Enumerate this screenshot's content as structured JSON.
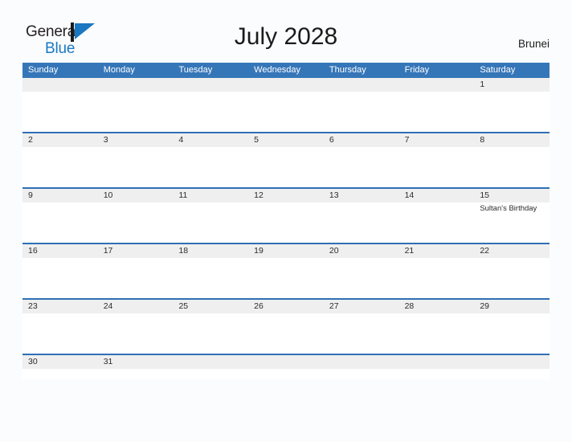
{
  "brand": {
    "word1": "General",
    "word2": "Blue",
    "flag_icon": "blue-triangle-flag-icon",
    "color_dark": "#231f20",
    "color_blue": "#1a78c2"
  },
  "header": {
    "title": "July 2028",
    "country": "Brunei"
  },
  "theme": {
    "header_blue": "#3576b8",
    "row_border_blue": "#2f6fb5",
    "day_band_gray": "#efefef",
    "page_background": "#fbfcfd",
    "text_dark": "#2b2b2b"
  },
  "calendar": {
    "weekdays": [
      "Sunday",
      "Monday",
      "Tuesday",
      "Wednesday",
      "Thursday",
      "Friday",
      "Saturday"
    ],
    "weeks": [
      [
        {
          "date": "",
          "event": ""
        },
        {
          "date": "",
          "event": ""
        },
        {
          "date": "",
          "event": ""
        },
        {
          "date": "",
          "event": ""
        },
        {
          "date": "",
          "event": ""
        },
        {
          "date": "",
          "event": ""
        },
        {
          "date": "1",
          "event": ""
        }
      ],
      [
        {
          "date": "2",
          "event": ""
        },
        {
          "date": "3",
          "event": ""
        },
        {
          "date": "4",
          "event": ""
        },
        {
          "date": "5",
          "event": ""
        },
        {
          "date": "6",
          "event": ""
        },
        {
          "date": "7",
          "event": ""
        },
        {
          "date": "8",
          "event": ""
        }
      ],
      [
        {
          "date": "9",
          "event": ""
        },
        {
          "date": "10",
          "event": ""
        },
        {
          "date": "11",
          "event": ""
        },
        {
          "date": "12",
          "event": ""
        },
        {
          "date": "13",
          "event": ""
        },
        {
          "date": "14",
          "event": ""
        },
        {
          "date": "15",
          "event": "Sultan's Birthday"
        }
      ],
      [
        {
          "date": "16",
          "event": ""
        },
        {
          "date": "17",
          "event": ""
        },
        {
          "date": "18",
          "event": ""
        },
        {
          "date": "19",
          "event": ""
        },
        {
          "date": "20",
          "event": ""
        },
        {
          "date": "21",
          "event": ""
        },
        {
          "date": "22",
          "event": ""
        }
      ],
      [
        {
          "date": "23",
          "event": ""
        },
        {
          "date": "24",
          "event": ""
        },
        {
          "date": "25",
          "event": ""
        },
        {
          "date": "26",
          "event": ""
        },
        {
          "date": "27",
          "event": ""
        },
        {
          "date": "28",
          "event": ""
        },
        {
          "date": "29",
          "event": ""
        }
      ],
      [
        {
          "date": "30",
          "event": ""
        },
        {
          "date": "31",
          "event": ""
        },
        {
          "date": "",
          "event": ""
        },
        {
          "date": "",
          "event": ""
        },
        {
          "date": "",
          "event": ""
        },
        {
          "date": "",
          "event": ""
        },
        {
          "date": "",
          "event": ""
        }
      ]
    ]
  }
}
